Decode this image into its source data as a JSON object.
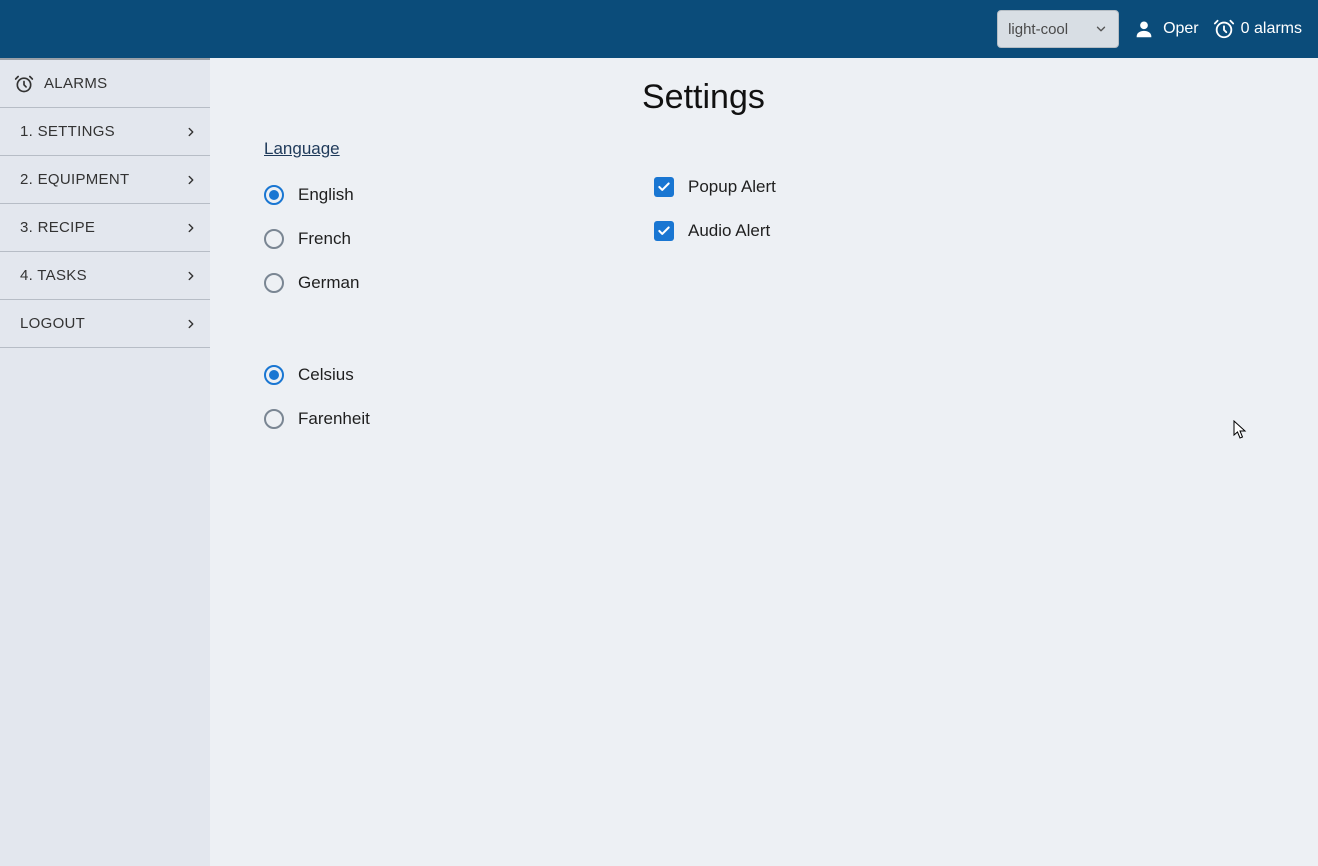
{
  "header": {
    "theme_selected": "light-cool",
    "username": "Oper",
    "alarms_text": "0 alarms"
  },
  "sidebar": {
    "items": [
      {
        "label": "ALARMS",
        "has_icon": true,
        "has_chevron": false
      },
      {
        "label": "1. SETTINGS",
        "has_icon": false,
        "has_chevron": true
      },
      {
        "label": "2. EQUIPMENT",
        "has_icon": false,
        "has_chevron": true
      },
      {
        "label": "3. RECIPE",
        "has_icon": false,
        "has_chevron": true
      },
      {
        "label": "4. TASKS",
        "has_icon": false,
        "has_chevron": true
      },
      {
        "label": "LOGOUT",
        "has_icon": false,
        "has_chevron": true
      }
    ]
  },
  "main": {
    "title": "Settings",
    "language_heading": "Language",
    "languages": [
      {
        "label": "English",
        "selected": true
      },
      {
        "label": "French",
        "selected": false
      },
      {
        "label": "German",
        "selected": false
      }
    ],
    "temperature": [
      {
        "label": "Celsius",
        "selected": true
      },
      {
        "label": "Farenheit",
        "selected": false
      }
    ],
    "alerts": [
      {
        "label": "Popup Alert",
        "checked": true
      },
      {
        "label": "Audio Alert",
        "checked": true
      }
    ]
  }
}
